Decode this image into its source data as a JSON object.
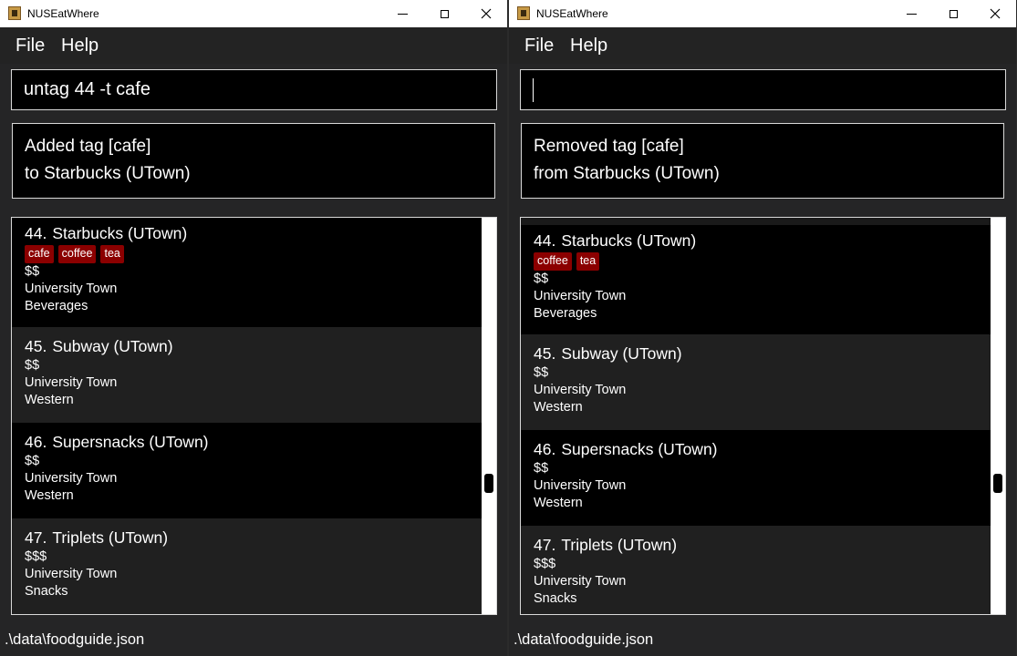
{
  "windows": [
    {
      "title": "NUSEatWhere",
      "menu": {
        "file": "File",
        "help": "Help"
      },
      "command_input": {
        "value": "untag 44 -t cafe"
      },
      "result": {
        "line1": "Added tag [cafe]",
        "line2": "to Starbucks (UTown)"
      },
      "cards": [
        {
          "index": "44.",
          "name": "Starbucks (UTown)",
          "tags": [
            "cafe",
            "coffee",
            "tea"
          ],
          "price": "$$",
          "location": "University Town",
          "category": "Beverages"
        },
        {
          "index": "45.",
          "name": "Subway (UTown)",
          "tags": [],
          "price": "$$",
          "location": "University Town",
          "category": "Western"
        },
        {
          "index": "46.",
          "name": "Supersnacks (UTown)",
          "tags": [],
          "price": "$$",
          "location": "University Town",
          "category": "Western"
        },
        {
          "index": "47.",
          "name": "Triplets (UTown)",
          "tags": [],
          "price": "$$$",
          "location": "University Town",
          "category": "Snacks"
        }
      ],
      "status": ".\\data\\foodguide.json"
    },
    {
      "title": "NUSEatWhere",
      "menu": {
        "file": "File",
        "help": "Help"
      },
      "command_input": {
        "value": ""
      },
      "result": {
        "line1": "Removed tag [cafe]",
        "line2": "from Starbucks (UTown)"
      },
      "cards": [
        {
          "index": "44.",
          "name": "Starbucks (UTown)",
          "tags": [
            "coffee",
            "tea"
          ],
          "price": "$$",
          "location": "University Town",
          "category": "Beverages"
        },
        {
          "index": "45.",
          "name": "Subway (UTown)",
          "tags": [],
          "price": "$$",
          "location": "University Town",
          "category": "Western"
        },
        {
          "index": "46.",
          "name": "Supersnacks (UTown)",
          "tags": [],
          "price": "$$",
          "location": "University Town",
          "category": "Western"
        },
        {
          "index": "47.",
          "name": "Triplets (UTown)",
          "tags": [],
          "price": "$$$",
          "location": "University Town",
          "category": "Snacks"
        }
      ],
      "status": ".\\data\\foodguide.json"
    }
  ],
  "icons": {
    "app": "app-icon",
    "minimize": "minimize-icon",
    "maximize": "maximize-icon",
    "close": "close-icon"
  },
  "colors": {
    "tag_background": "#8b0000",
    "card_dark": "#000000",
    "card_light": "#202020",
    "titlebar": "#ffffff"
  }
}
